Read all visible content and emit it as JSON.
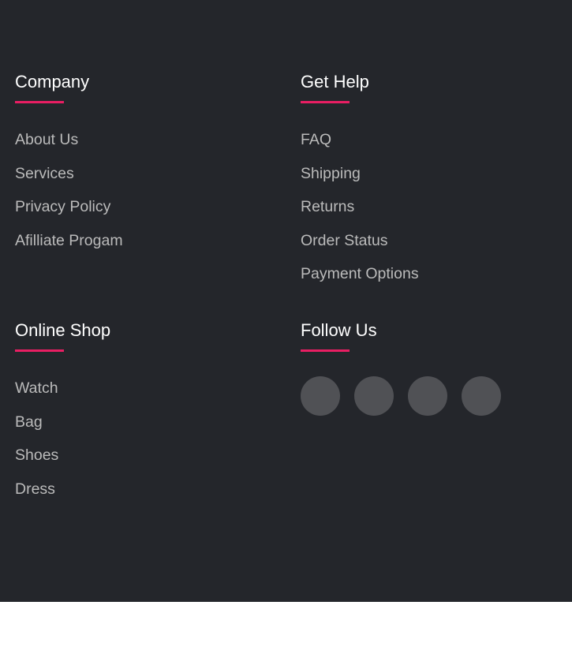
{
  "sections": [
    {
      "title": "Company",
      "links": [
        "About Us",
        "Services",
        "Privacy Policy",
        "Afilliate Progam"
      ]
    },
    {
      "title": "Get Help",
      "links": [
        "FAQ",
        "Shipping",
        "Returns",
        "Order Status",
        "Payment Options"
      ]
    },
    {
      "title": "Online Shop",
      "links": [
        "Watch",
        "Bag",
        "Shoes",
        "Dress"
      ]
    }
  ],
  "follow": {
    "title": "Follow Us",
    "icons": [
      "social-icon-1",
      "social-icon-2",
      "social-icon-3",
      "social-icon-4"
    ]
  },
  "colors": {
    "background": "#24262b",
    "accent": "#e91e63",
    "link": "#bbbbbb",
    "social_circle": "#505155"
  }
}
